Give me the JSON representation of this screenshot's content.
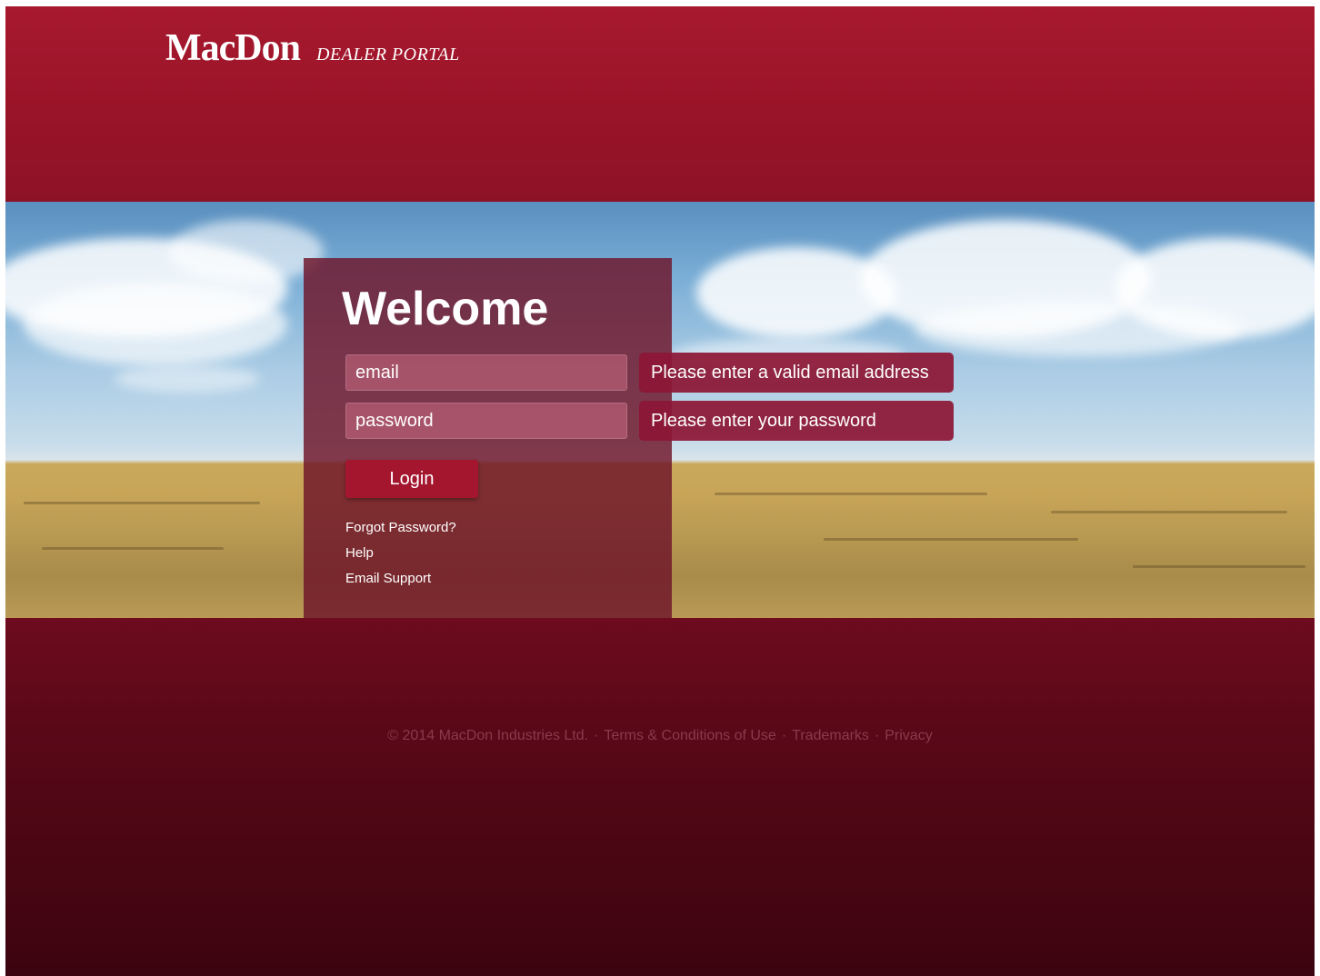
{
  "header": {
    "logo_text": "MacDon",
    "portal_label": "DEALER PORTAL"
  },
  "login": {
    "title": "Welcome",
    "email_placeholder": "email",
    "password_placeholder": "password",
    "login_label": "Login",
    "links": [
      "Forgot Password?",
      "Help",
      "Email Support"
    ]
  },
  "validation": {
    "email_error": "Please enter a valid email address",
    "password_error": "Please enter your password"
  },
  "footer": {
    "copyright": "© 2014 MacDon Industries Ltd.",
    "links": [
      "Terms & Conditions of Use",
      "Trademarks",
      "Privacy"
    ],
    "separator": "·"
  },
  "colors": {
    "brand_red": "#a8192f",
    "footer_dark": "#480612"
  }
}
